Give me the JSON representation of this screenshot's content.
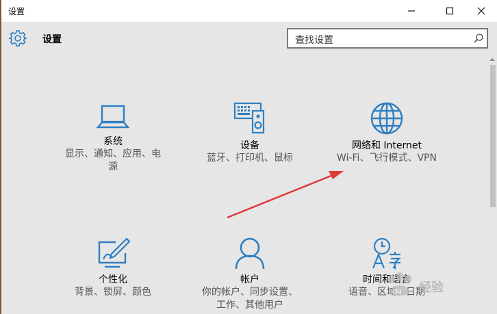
{
  "window": {
    "title": "设置",
    "controls": [
      "minimize",
      "maximize",
      "close"
    ]
  },
  "header": {
    "icon": "gear-icon",
    "title": "设置"
  },
  "search": {
    "placeholder": "查找设置",
    "icon": "search-icon"
  },
  "tiles": [
    {
      "icon": "laptop-icon",
      "title": "系统",
      "desc1": "显示、通知、应用、电",
      "desc2": "源"
    },
    {
      "icon": "devices-icon",
      "title": "设备",
      "desc1": "蓝牙、打印机、鼠标",
      "desc2": ""
    },
    {
      "icon": "globe-icon",
      "title": "网络和 Internet",
      "desc1": "Wi-Fi、飞行模式、VPN",
      "desc2": ""
    },
    {
      "icon": "personalization-icon",
      "title": "个性化",
      "desc1": "背景、锁屏、颜色",
      "desc2": ""
    },
    {
      "icon": "account-icon",
      "title": "帐户",
      "desc1": "你的帐户、同步设置、",
      "desc2": "工作、其他用户"
    },
    {
      "icon": "time-language-icon",
      "title": "时间和语言",
      "desc1": "语音、区域、日期",
      "desc2": ""
    }
  ],
  "annotation": {
    "color": "#e03a3a"
  },
  "watermark": {
    "text": "经验",
    "brand": "Bai du"
  },
  "colors": {
    "accent": "#2f7fc1",
    "window_bg": "#e6e6e6"
  }
}
